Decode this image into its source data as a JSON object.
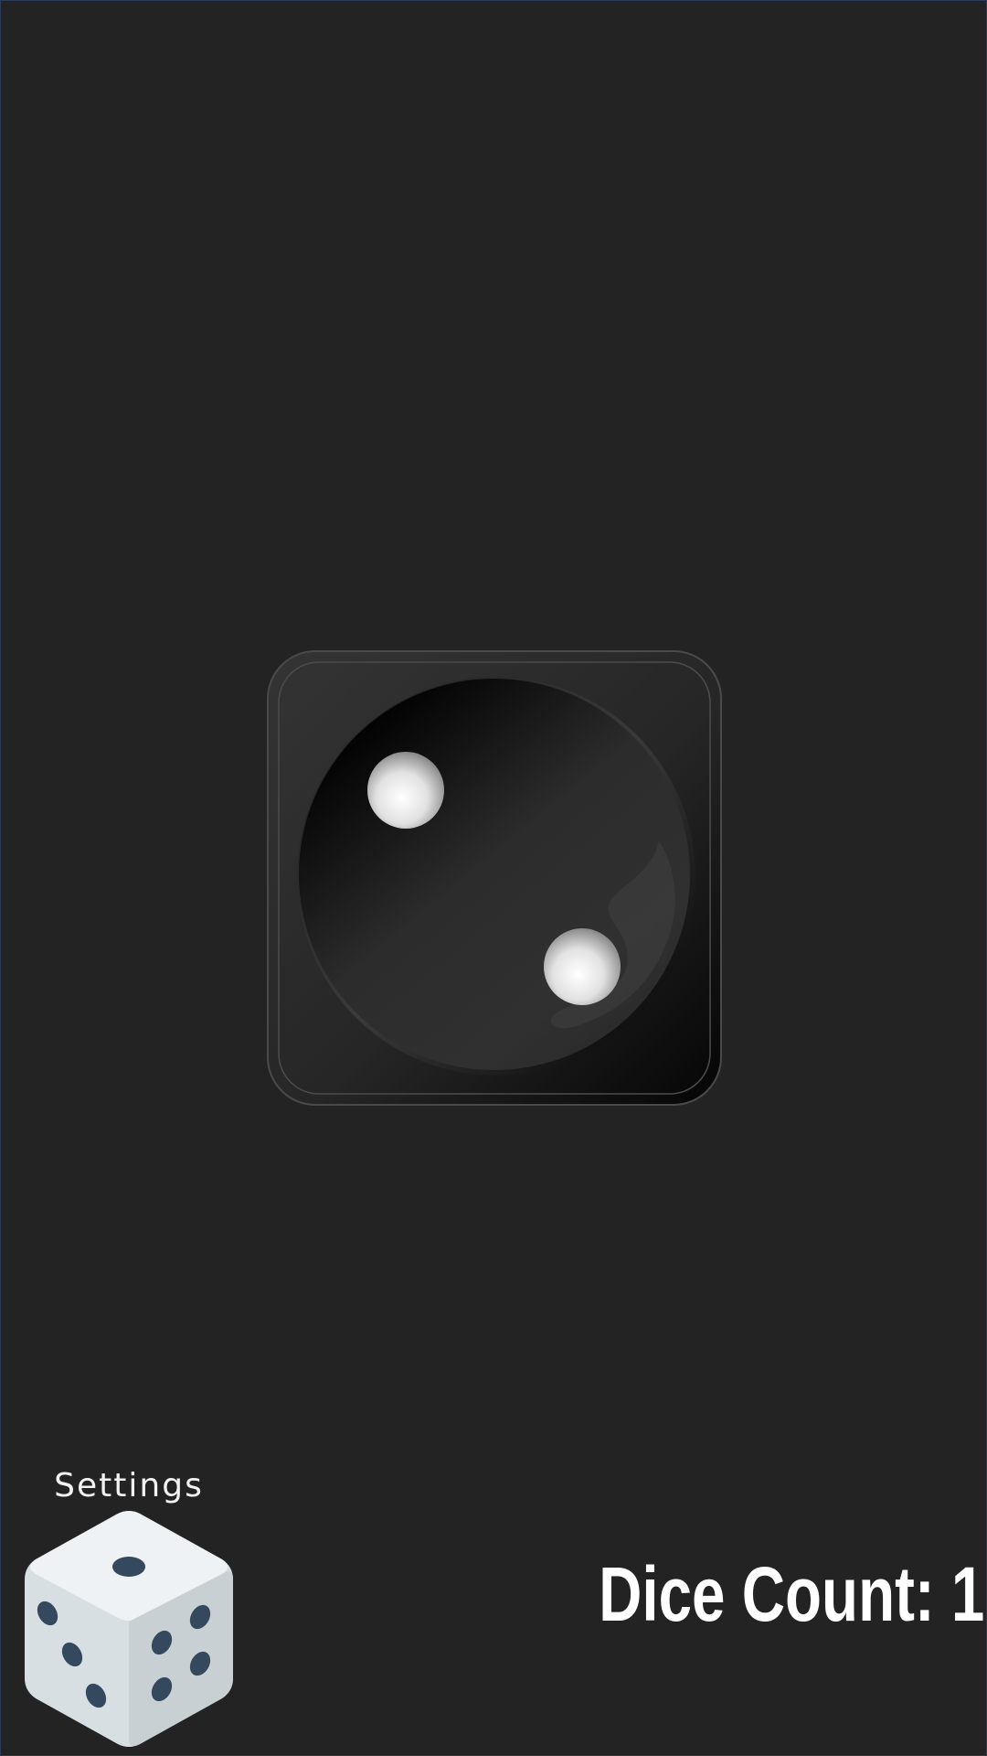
{
  "main_die": {
    "face_value": 2,
    "icon": "die-face-two-icon"
  },
  "settings": {
    "label": "Settings",
    "icon": "dice-settings-icon"
  },
  "dice_count": {
    "text": "Dice Count: 1"
  },
  "colors": {
    "background": "#232323",
    "die_body": "#2a2a2a",
    "pip": "#e6e6e6",
    "settings_die_light": "#eef2f4",
    "settings_die_mid": "#d7dfe3",
    "settings_die_dark": "#c8d0d4",
    "settings_pip": "#34495e"
  }
}
